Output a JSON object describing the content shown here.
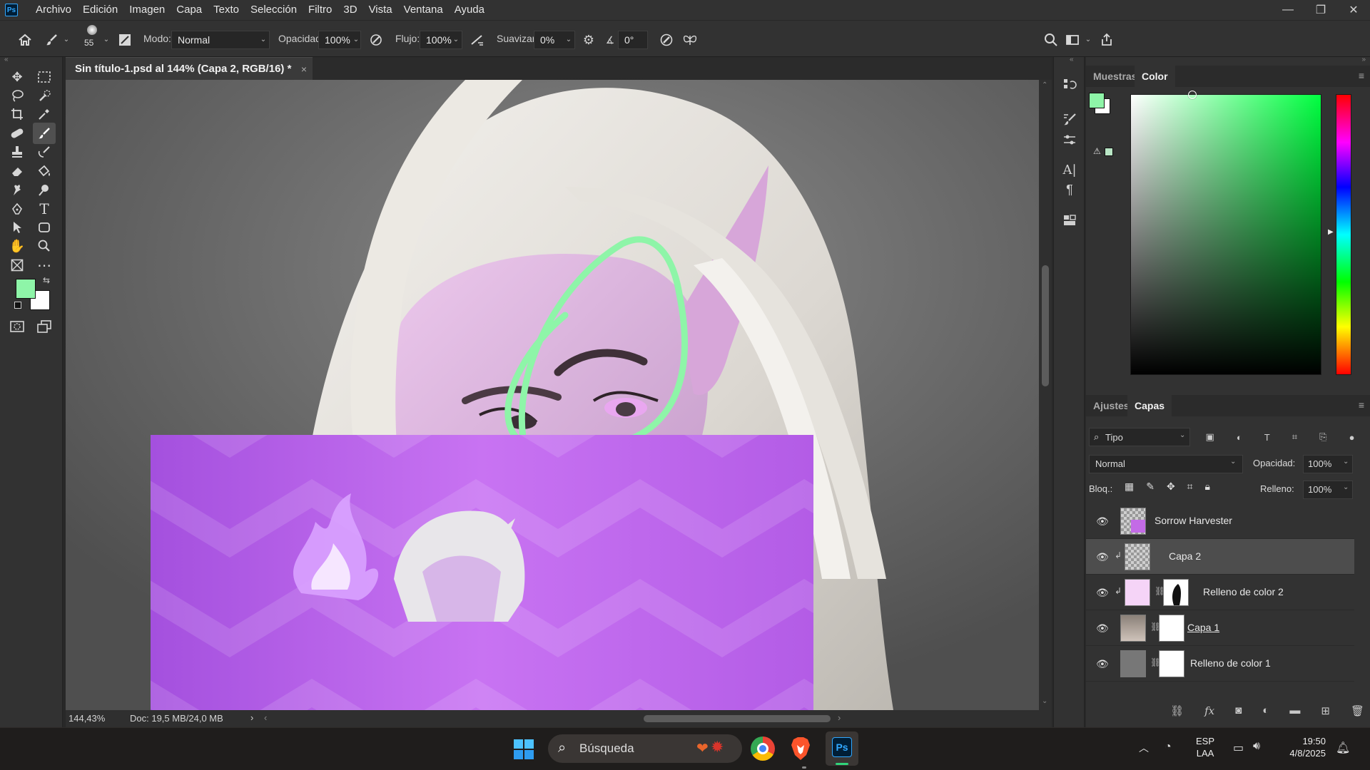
{
  "app": {
    "logo": "Ps"
  },
  "menu": [
    "Archivo",
    "Edición",
    "Imagen",
    "Capa",
    "Texto",
    "Selección",
    "Filtro",
    "3D",
    "Vista",
    "Ventana",
    "Ayuda"
  ],
  "window_controls": {
    "minimize": "—",
    "restore": "❐",
    "close": "✕"
  },
  "options": {
    "brush_size": "55",
    "mode_label": "Modo:",
    "mode_value": "Normal",
    "opacity_label": "Opacidad:",
    "opacity_value": "100%",
    "flow_label": "Flujo:",
    "flow_value": "100%",
    "smoothing_label": "Suavizar:",
    "smoothing_value": "0%",
    "angle_value": "0°"
  },
  "document": {
    "tab_title": "Sin título-1.psd al 144% (Capa 2, RGB/16) *",
    "close_glyph": "×",
    "zoom": "144,43%",
    "doc_size": "Doc: 19,5 MB/24,0 MB",
    "status_arrow": "›",
    "hscroll_left": "‹",
    "hscroll_right": "›"
  },
  "colors": {
    "foreground": "#8ef5a8",
    "background": "#ffffff",
    "accent": "#31a8ff"
  },
  "color_panel": {
    "tabs": [
      "Muestras",
      "Color"
    ],
    "active_tab": "Color"
  },
  "layers_panel": {
    "tabs": [
      "Ajustes",
      "Capas"
    ],
    "active_tab": "Capas",
    "filter_label": "Tipo",
    "blend_mode": "Normal",
    "opacity_label": "Opacidad:",
    "opacity_value": "100%",
    "lock_label": "Bloq.:",
    "fill_label": "Relleno:",
    "fill_value": "100%",
    "layers": [
      {
        "name": "Sorrow Harvester",
        "selected": false
      },
      {
        "name": "Capa 2",
        "selected": true
      },
      {
        "name": "Relleno de color 2",
        "selected": false
      },
      {
        "name": "Capa 1",
        "selected": false
      },
      {
        "name": "Relleno de color 1",
        "selected": false
      }
    ]
  },
  "taskbar": {
    "search_placeholder": "Búsqueda",
    "language": "ESP",
    "layout": "LAA",
    "time": "19:50",
    "date": "4/8/2025"
  }
}
